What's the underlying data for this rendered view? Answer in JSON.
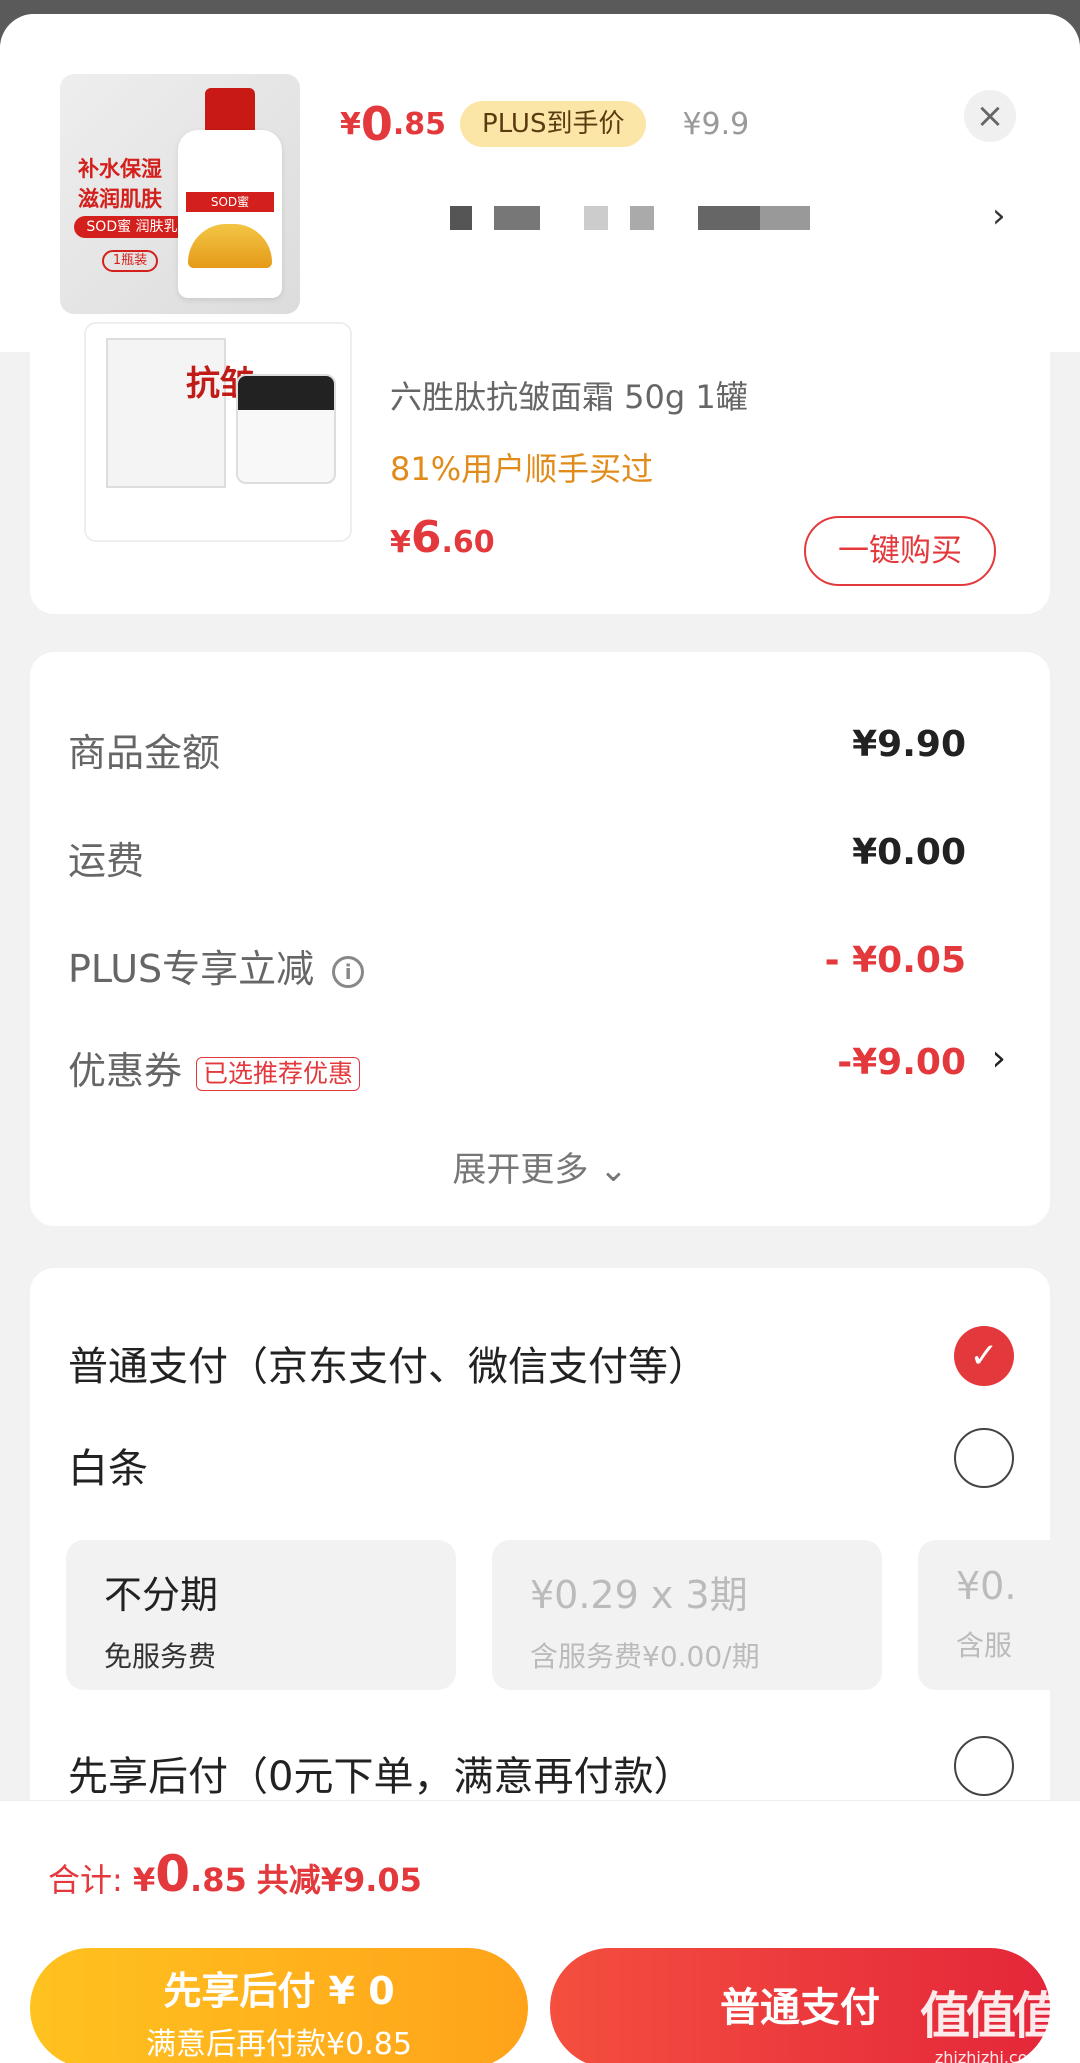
{
  "header": {
    "product_image_text": "补水保湿 滋润肌肤",
    "product_image_sub": "SOD蜜 润肤乳",
    "product_image_pack": "1瓶装",
    "product_image_tag": "SOD蜜",
    "price_currency": "¥",
    "price_int": "0",
    "price_dec": ".85",
    "plus_label": "PLUS到手价",
    "original_price": "¥9.9",
    "close_icon": "close-icon",
    "close_glyph": "×",
    "chevron_glyph": "›"
  },
  "recommend": {
    "image_text": "抗皱",
    "title": "六胜肽抗皱面霜 50g 1罐",
    "stat": "81%用户顺手买过",
    "price_currency": "¥",
    "price_int": "6",
    "price_dec": ".60",
    "buy_button": "一键购买"
  },
  "summary": {
    "rows": [
      {
        "label": "商品金额",
        "value": "¥9.90"
      },
      {
        "label": "运费",
        "value": "¥0.00"
      },
      {
        "label": "PLUS专享立减",
        "value": "- ¥0.05"
      },
      {
        "label": "优惠券",
        "value": "-¥9.00",
        "tag": "已选推荐优惠"
      }
    ],
    "info_glyph": "i",
    "chevron_glyph": "›",
    "expand": "展开更多 ⌄"
  },
  "payment": {
    "normal": "普通支付（京东支付、微信支付等）",
    "check_glyph": "✓",
    "baitiao": "白条",
    "installments": [
      {
        "main": "不分期",
        "sub": "免服务费"
      },
      {
        "main": "¥0.29 x 3期",
        "sub": "含服务费¥0.00/期"
      },
      {
        "main": "¥0.",
        "sub": "含服"
      }
    ],
    "later": "先享后付（0元下单，满意再付款）"
  },
  "footer": {
    "total_label": "合计: ",
    "total_currency": "¥",
    "total_int": "0",
    "total_dec": ".85",
    "total_saved": "共减¥9.05",
    "later_line1": "先享后付 ¥ 0",
    "later_line2": "满意后再付款¥0.85",
    "pay_button": "普通支付"
  },
  "watermark": {
    "big": "值值值",
    "small": "zhizhizhi.com"
  },
  "colors": {
    "accent": "#e4393c",
    "plus_pill": "#fbe6a8",
    "later_button": "#ffb21d",
    "stat_orange": "#e08b1a"
  }
}
